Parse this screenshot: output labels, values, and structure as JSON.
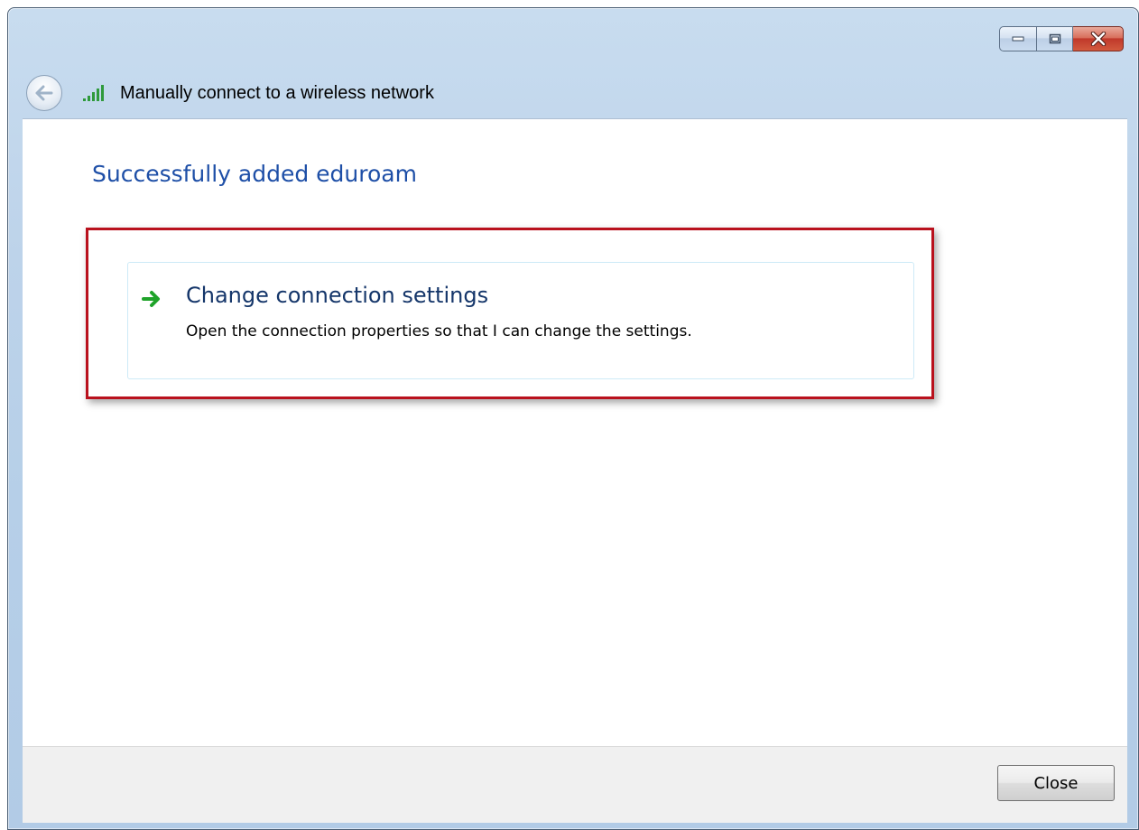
{
  "window": {
    "title": "Manually connect to a wireless network"
  },
  "content": {
    "heading": "Successfully added eduroam",
    "command_link": {
      "title": "Change connection settings",
      "description": "Open the connection properties so that I can change the settings."
    }
  },
  "footer": {
    "close_label": "Close"
  },
  "colors": {
    "heading": "#1e4fa7",
    "highlight_frame": "#b9111d",
    "arrow": "#1fa32a"
  },
  "icons": {
    "back": "back-arrow-icon",
    "signal": "wireless-signal-icon",
    "arrow": "green-arrow-icon",
    "minimize": "minimize-icon",
    "maximize": "maximize-icon",
    "close": "close-icon"
  }
}
